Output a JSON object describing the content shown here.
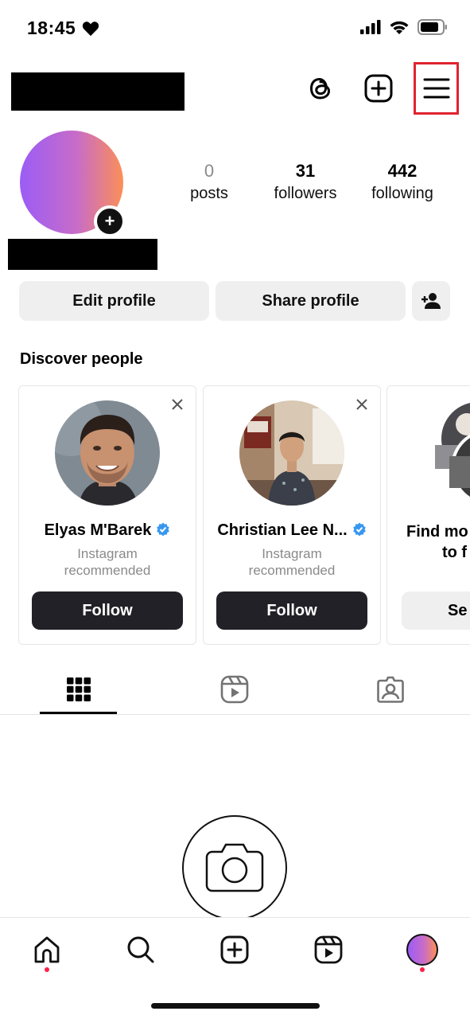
{
  "status_bar": {
    "time": "18:45"
  },
  "profile": {
    "stats": [
      {
        "value": "0",
        "label": "posts"
      },
      {
        "value": "31",
        "label": "followers"
      },
      {
        "value": "442",
        "label": "following"
      }
    ],
    "edit_profile_label": "Edit profile",
    "share_profile_label": "Share profile"
  },
  "discover": {
    "title": "Discover people",
    "cards": [
      {
        "name": "Elyas M'Barek",
        "subtitle_line1": "Instagram",
        "subtitle_line2": "recommended",
        "button": "Follow"
      },
      {
        "name": "Christian Lee N...",
        "subtitle_line1": "Instagram",
        "subtitle_line2": "recommended",
        "button": "Follow"
      },
      {
        "name_line1": "Find mo",
        "name_line2": "to f",
        "button": "Se"
      }
    ]
  },
  "colors": {
    "accent_red": "#e0232f",
    "follow_button": "#212127",
    "notification_dot": "#ff1f4b",
    "verified_blue": "#3797f0"
  }
}
